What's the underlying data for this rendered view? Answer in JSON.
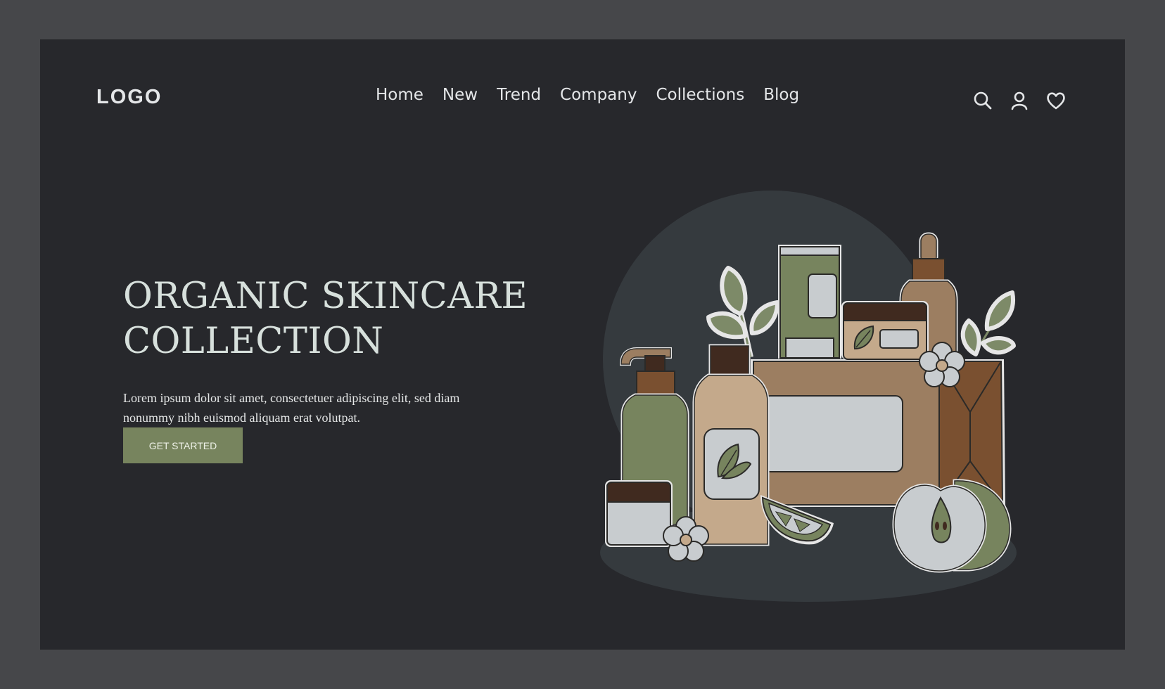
{
  "header": {
    "logo": "LOGO",
    "nav": [
      "Home",
      "New",
      "Trend",
      "Company",
      "Collections",
      "Blog"
    ],
    "icons": [
      "search-icon",
      "user-icon",
      "heart-icon"
    ]
  },
  "hero": {
    "title": "ORGANIC SKINCARE\nCOLLECTION",
    "description": "Lorem ipsum dolor sit amet, consectetuer adipiscing elit, sed diam nonummy nibh euismod aliquam erat volutpat.",
    "cta": "GET STARTED"
  },
  "colors": {
    "outer": "#46474a",
    "background": "#27282c",
    "accent_green": "#77845e",
    "brown": "#9c7e61",
    "dark_brown": "#402a1f",
    "beige": "#c4a98b",
    "light_gray": "#c8cccf"
  }
}
